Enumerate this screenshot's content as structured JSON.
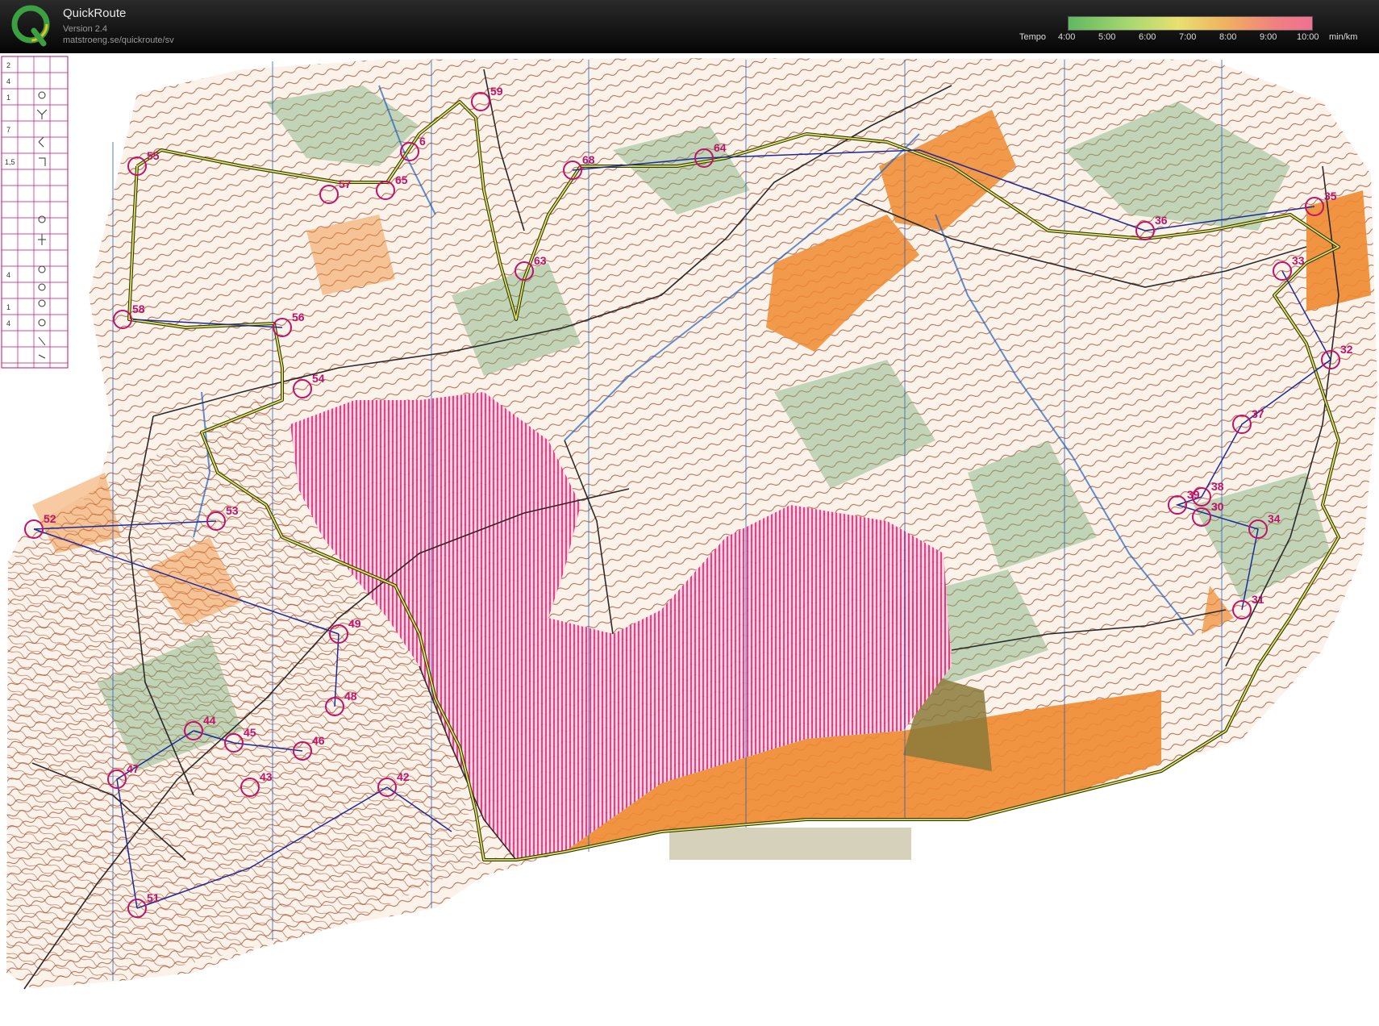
{
  "app": {
    "title": "QuickRoute",
    "version": "Version 2.4",
    "url": "matstroeng.se/quickroute/sv",
    "logo_letter": "Q"
  },
  "pace_legend": {
    "label": "Tempo",
    "ticks": [
      "4:00",
      "5:00",
      "6:00",
      "7:00",
      "8:00",
      "9:00",
      "10:00"
    ],
    "unit": "min/km",
    "colors": [
      "#60b860",
      "#a8d870",
      "#e8e070",
      "#f0b060",
      "#f08080",
      "#f07090"
    ]
  },
  "map": {
    "colors": {
      "control": "#c0126a",
      "route": "#1a2a9a",
      "contour": "#9a3a1a",
      "open_land": "#f08a30",
      "forbidden": "#e0307a",
      "vegetation": "#7ab07a",
      "water": "#2060c0"
    },
    "control_descriptions": [
      "2",
      "4",
      "1",
      "7",
      "1,5",
      "4",
      "1",
      "4"
    ],
    "controls": [
      "55",
      "57",
      "65",
      "59",
      "6",
      "68",
      "64",
      "63",
      "58",
      "56",
      "54",
      "52",
      "53",
      "49",
      "48",
      "44",
      "45",
      "46",
      "47",
      "43",
      "42",
      "51",
      "36",
      "35",
      "33",
      "32",
      "37",
      "38",
      "39",
      "30",
      "34",
      "31"
    ]
  }
}
